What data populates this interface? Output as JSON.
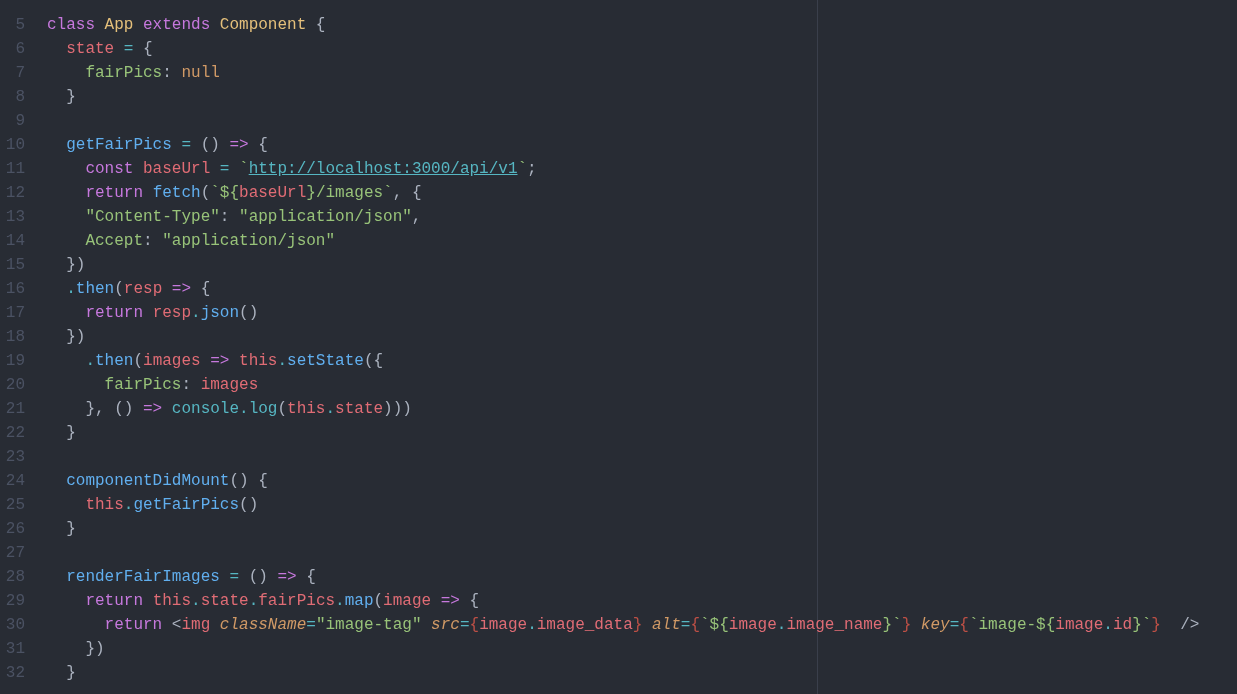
{
  "editor": {
    "lines": [
      {
        "number": "5",
        "tokens": [
          {
            "kind": "kw",
            "text": "class "
          },
          {
            "kind": "cls",
            "text": "App "
          },
          {
            "kind": "kw",
            "text": "extends "
          },
          {
            "kind": "cls",
            "text": "Component"
          },
          {
            "kind": "punct",
            "text": " {"
          }
        ]
      },
      {
        "number": "6",
        "tokens": [
          {
            "kind": "var",
            "text": "  state"
          },
          {
            "kind": "op",
            "text": " = "
          },
          {
            "kind": "punct",
            "text": "{"
          }
        ]
      },
      {
        "number": "7",
        "tokens": [
          {
            "kind": "key",
            "text": "    fairPics"
          },
          {
            "kind": "punct",
            "text": ": "
          },
          {
            "kind": "null",
            "text": "null"
          }
        ]
      },
      {
        "number": "8",
        "tokens": [
          {
            "kind": "punct",
            "text": "  }"
          }
        ]
      },
      {
        "number": "9"
      },
      {
        "number": "10",
        "tokens": [
          {
            "kind": "fn",
            "text": "  getFairPics"
          },
          {
            "kind": "op",
            "text": " = "
          },
          {
            "kind": "punct",
            "text": "() "
          },
          {
            "kind": "kw",
            "text": "=>"
          },
          {
            "kind": "punct",
            "text": " {"
          }
        ]
      },
      {
        "number": "11",
        "tokens": [
          {
            "kind": "kw",
            "text": "    const "
          },
          {
            "kind": "var",
            "text": "baseUrl"
          },
          {
            "kind": "op",
            "text": " = "
          },
          {
            "kind": "str",
            "text": "`"
          },
          {
            "kind": "link",
            "text": "http://localhost:3000/api/v1"
          },
          {
            "kind": "str",
            "text": "`"
          },
          {
            "kind": "punct",
            "text": ";"
          }
        ]
      },
      {
        "number": "12",
        "tokens": [
          {
            "kind": "kw",
            "text": "    return "
          },
          {
            "kind": "fn",
            "text": "fetch"
          },
          {
            "kind": "punct",
            "text": "("
          },
          {
            "kind": "str",
            "text": "`${"
          },
          {
            "kind": "var",
            "text": "baseUrl"
          },
          {
            "kind": "str",
            "text": "}/images`"
          },
          {
            "kind": "punct",
            "text": ", {"
          }
        ]
      },
      {
        "number": "13",
        "tokens": [
          {
            "kind": "str",
            "text": "    \"Content-Type\""
          },
          {
            "kind": "punct",
            "text": ": "
          },
          {
            "kind": "str",
            "text": "\"application/json\""
          },
          {
            "kind": "punct",
            "text": ","
          }
        ]
      },
      {
        "number": "14",
        "tokens": [
          {
            "kind": "str",
            "text": "    Accept"
          },
          {
            "kind": "punct",
            "text": ": "
          },
          {
            "kind": "str",
            "text": "\"application/json\""
          }
        ]
      },
      {
        "number": "15",
        "tokens": [
          {
            "kind": "punct",
            "text": "  })"
          }
        ]
      },
      {
        "number": "16",
        "tokens": [
          {
            "kind": "op",
            "text": "  ."
          },
          {
            "kind": "fn",
            "text": "then"
          },
          {
            "kind": "punct",
            "text": "("
          },
          {
            "kind": "var",
            "text": "resp"
          },
          {
            "kind": "kw",
            "text": " => "
          },
          {
            "kind": "punct",
            "text": "{"
          }
        ]
      },
      {
        "number": "17",
        "tokens": [
          {
            "kind": "kw",
            "text": "    return "
          },
          {
            "kind": "var",
            "text": "resp"
          },
          {
            "kind": "op",
            "text": "."
          },
          {
            "kind": "fn",
            "text": "json"
          },
          {
            "kind": "punct",
            "text": "()"
          }
        ]
      },
      {
        "number": "18",
        "tokens": [
          {
            "kind": "punct",
            "text": "  })"
          }
        ]
      },
      {
        "number": "19",
        "tokens": [
          {
            "kind": "op",
            "text": "    ."
          },
          {
            "kind": "fn",
            "text": "then"
          },
          {
            "kind": "punct",
            "text": "("
          },
          {
            "kind": "var",
            "text": "images"
          },
          {
            "kind": "kw",
            "text": " => "
          },
          {
            "kind": "var",
            "text": "this"
          },
          {
            "kind": "op",
            "text": "."
          },
          {
            "kind": "fn",
            "text": "setState"
          },
          {
            "kind": "punct",
            "text": "({"
          }
        ]
      },
      {
        "number": "20",
        "tokens": [
          {
            "kind": "key",
            "text": "      fairPics"
          },
          {
            "kind": "punct",
            "text": ": "
          },
          {
            "kind": "var",
            "text": "images"
          }
        ]
      },
      {
        "number": "21",
        "tokens": [
          {
            "kind": "punct",
            "text": "    }, () "
          },
          {
            "kind": "kw",
            "text": "=> "
          },
          {
            "kind": "op",
            "text": "console.log"
          },
          {
            "kind": "punct",
            "text": "("
          },
          {
            "kind": "var",
            "text": "this"
          },
          {
            "kind": "op",
            "text": "."
          },
          {
            "kind": "var",
            "text": "state"
          },
          {
            "kind": "punct",
            "text": ")))"
          }
        ]
      },
      {
        "number": "22",
        "tokens": [
          {
            "kind": "punct",
            "text": "  }"
          }
        ]
      },
      {
        "number": "23"
      },
      {
        "number": "24",
        "tokens": [
          {
            "kind": "fn",
            "text": "  componentDidMount"
          },
          {
            "kind": "punct",
            "text": "() {"
          }
        ]
      },
      {
        "number": "25",
        "tokens": [
          {
            "kind": "var",
            "text": "    this"
          },
          {
            "kind": "op",
            "text": "."
          },
          {
            "kind": "fn",
            "text": "getFairPics"
          },
          {
            "kind": "punct",
            "text": "()"
          }
        ]
      },
      {
        "number": "26",
        "tokens": [
          {
            "kind": "punct",
            "text": "  }"
          }
        ]
      },
      {
        "number": "27"
      },
      {
        "number": "28",
        "tokens": [
          {
            "kind": "fn",
            "text": "  renderFairImages"
          },
          {
            "kind": "op",
            "text": " = "
          },
          {
            "kind": "punct",
            "text": "() "
          },
          {
            "kind": "kw",
            "text": "=>"
          },
          {
            "kind": "punct",
            "text": " {"
          }
        ]
      },
      {
        "number": "29",
        "tokens": [
          {
            "kind": "kw",
            "text": "    return "
          },
          {
            "kind": "var",
            "text": "this"
          },
          {
            "kind": "op",
            "text": "."
          },
          {
            "kind": "var",
            "text": "state"
          },
          {
            "kind": "op",
            "text": "."
          },
          {
            "kind": "var",
            "text": "fairPics"
          },
          {
            "kind": "op",
            "text": "."
          },
          {
            "kind": "fn",
            "text": "map"
          },
          {
            "kind": "punct",
            "text": "("
          },
          {
            "kind": "var",
            "text": "image"
          },
          {
            "kind": "kw",
            "text": " => "
          },
          {
            "kind": "punct",
            "text": "{"
          }
        ]
      },
      {
        "number": "30",
        "tokens": [
          {
            "kind": "kw",
            "text": "      return "
          },
          {
            "kind": "punct",
            "text": "<"
          },
          {
            "kind": "var",
            "text": "img "
          },
          {
            "kind": "attr",
            "text": "className"
          },
          {
            "kind": "op",
            "text": "="
          },
          {
            "kind": "str",
            "text": "\"image-tag\" "
          },
          {
            "kind": "attr",
            "text": "src"
          },
          {
            "kind": "op",
            "text": "="
          },
          {
            "kind": "brace",
            "text": "{"
          },
          {
            "kind": "var",
            "text": "image"
          },
          {
            "kind": "op",
            "text": "."
          },
          {
            "kind": "var",
            "text": "image_data"
          },
          {
            "kind": "brace",
            "text": "}"
          },
          {
            "kind": "attr",
            "text": " alt"
          },
          {
            "kind": "op",
            "text": "="
          },
          {
            "kind": "brace",
            "text": "{"
          },
          {
            "kind": "str",
            "text": "`${"
          },
          {
            "kind": "var",
            "text": "image"
          },
          {
            "kind": "op",
            "text": "."
          },
          {
            "kind": "var",
            "text": "image_name"
          },
          {
            "kind": "str",
            "text": "}`"
          },
          {
            "kind": "brace",
            "text": "}"
          },
          {
            "kind": "attr",
            "text": " key"
          },
          {
            "kind": "op",
            "text": "="
          },
          {
            "kind": "brace",
            "text": "{"
          },
          {
            "kind": "str",
            "text": "`image-${"
          },
          {
            "kind": "var",
            "text": "image"
          },
          {
            "kind": "op",
            "text": "."
          },
          {
            "kind": "var",
            "text": "id"
          },
          {
            "kind": "str",
            "text": "}`"
          },
          {
            "kind": "brace",
            "text": "}"
          },
          {
            "kind": "punct",
            "text": "  />"
          }
        ]
      },
      {
        "number": "31",
        "tokens": [
          {
            "kind": "punct",
            "text": "    })"
          }
        ]
      },
      {
        "number": "32",
        "tokens": [
          {
            "kind": "punct",
            "text": "  }"
          }
        ]
      }
    ]
  }
}
